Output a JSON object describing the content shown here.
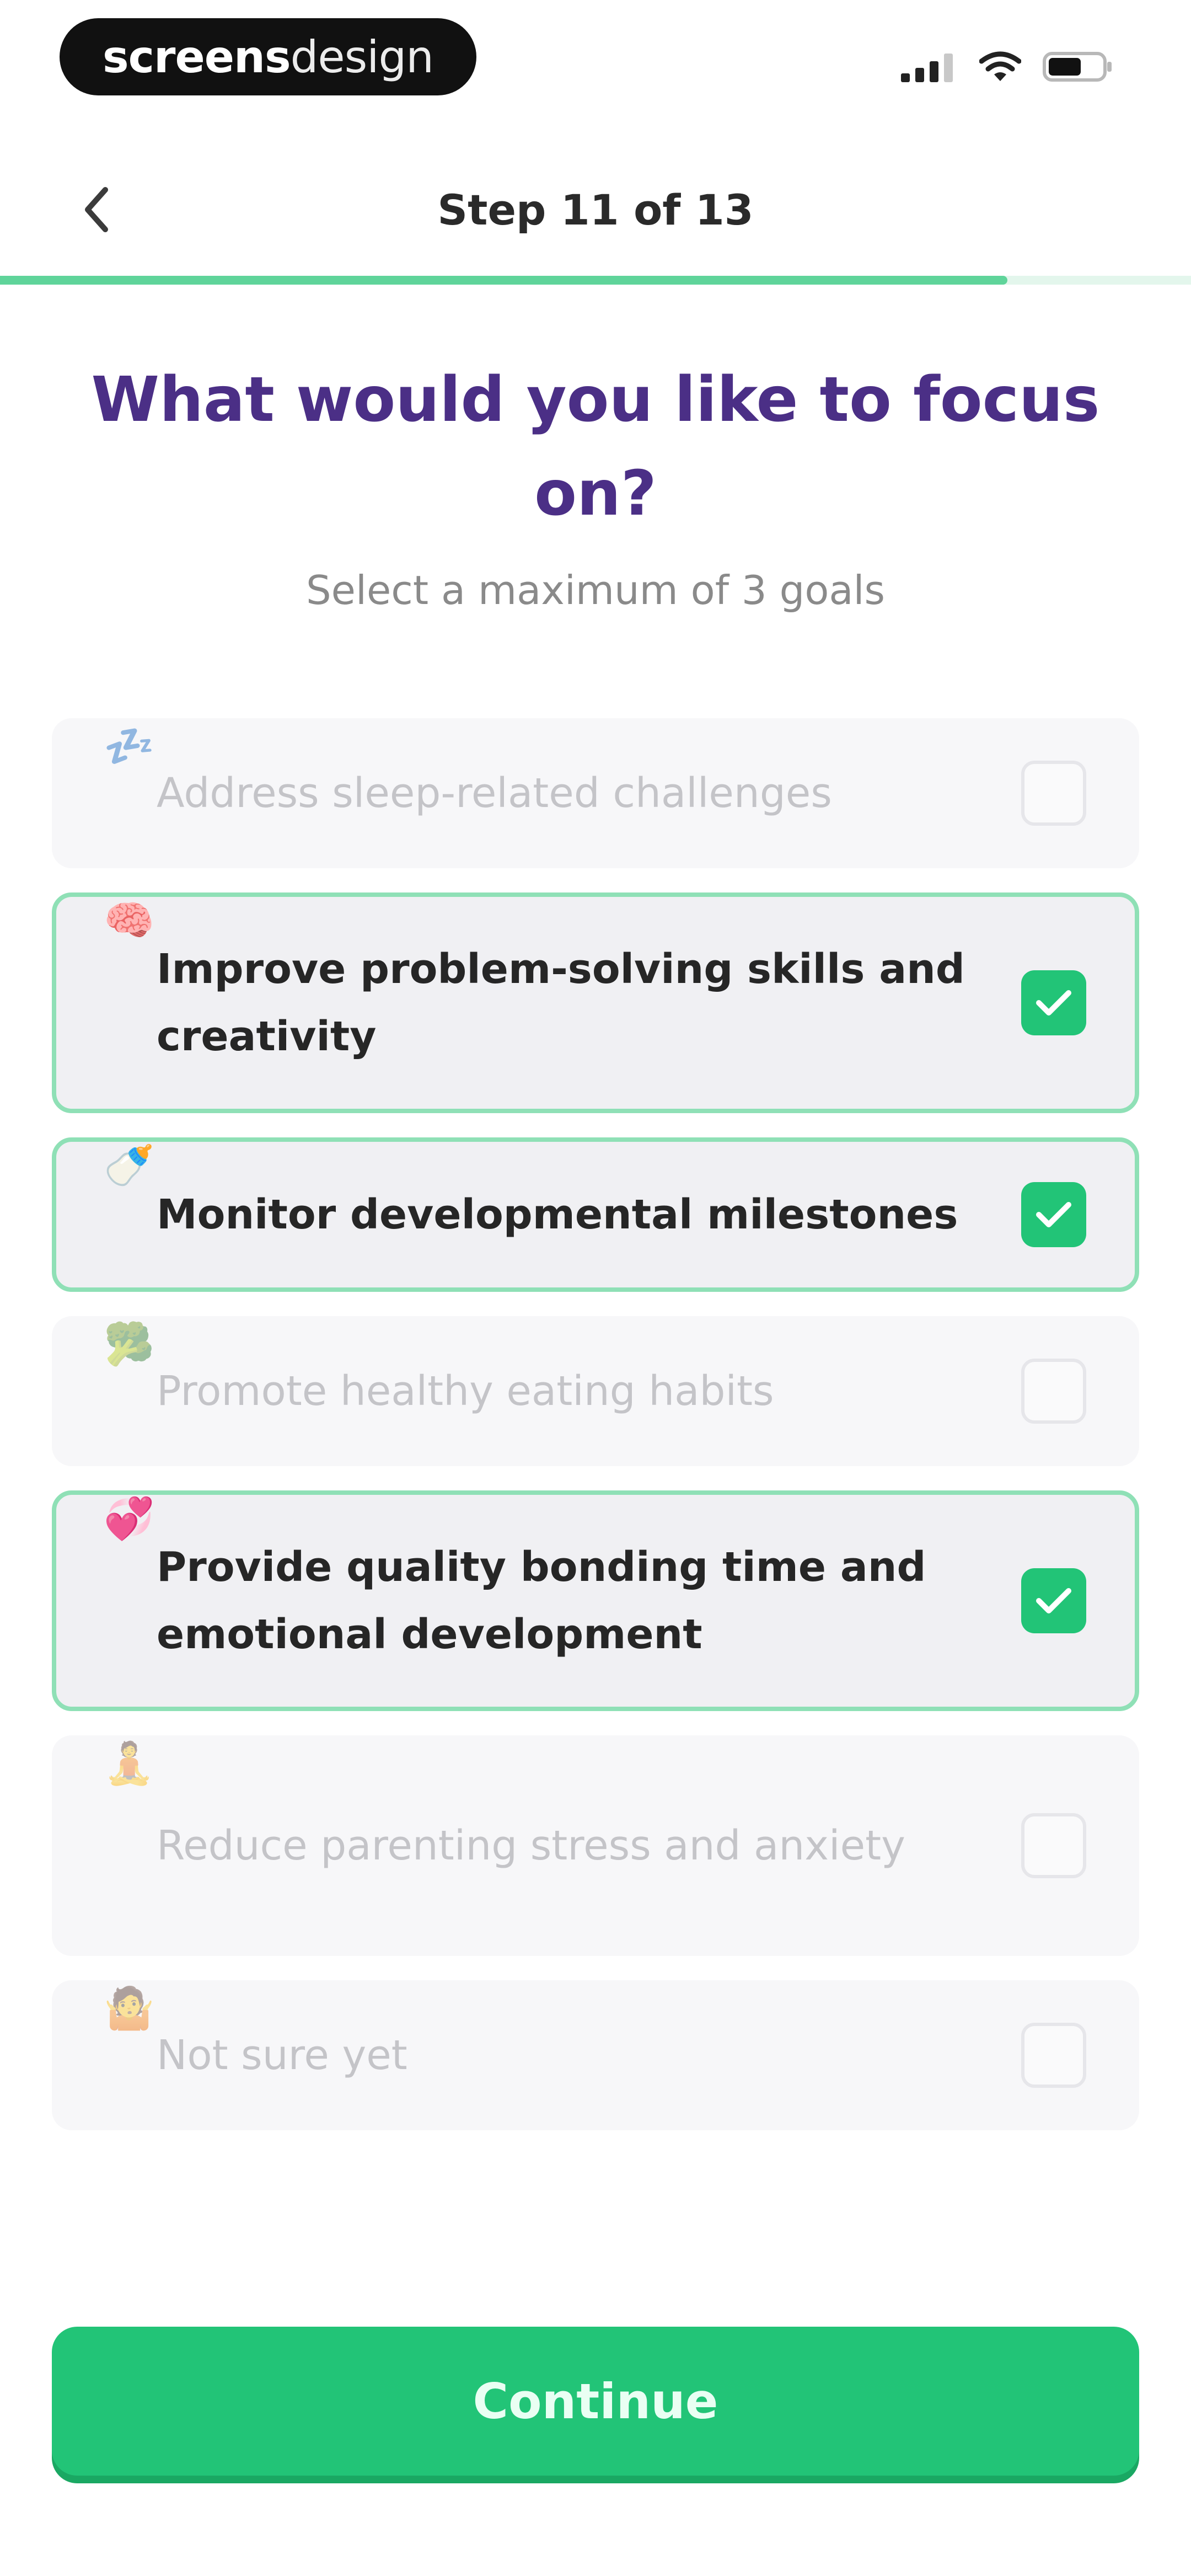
{
  "status_bar": {
    "brand_bold": "screens",
    "brand_light": "design"
  },
  "header": {
    "step_label": "Step 11 of 13",
    "progress_fraction": 0.846
  },
  "question": {
    "title": "What would you like to focus on?",
    "subtitle": "Select a maximum of 3 goals"
  },
  "options": [
    {
      "emoji": "💤",
      "label": "Address sleep-related challenges",
      "selected": false
    },
    {
      "emoji": "🧠",
      "label": "Improve problem-solving skills and creativity",
      "selected": true
    },
    {
      "emoji": "🍼",
      "label": "Monitor developmental milestones",
      "selected": true
    },
    {
      "emoji": "🥦",
      "label": "Promote healthy eating habits",
      "selected": false
    },
    {
      "emoji": "💞",
      "label": "Provide quality bonding time and emotional development",
      "selected": true
    },
    {
      "emoji": "🧘",
      "label": "Reduce parenting stress and anxiety",
      "selected": false
    },
    {
      "emoji": "🤷",
      "label": "Not sure yet",
      "selected": false
    }
  ],
  "continue_button": {
    "label": "Continue"
  },
  "colors": {
    "accent": "#22c477",
    "title": "#4b2f86",
    "selected_border": "#8fe0b6"
  }
}
